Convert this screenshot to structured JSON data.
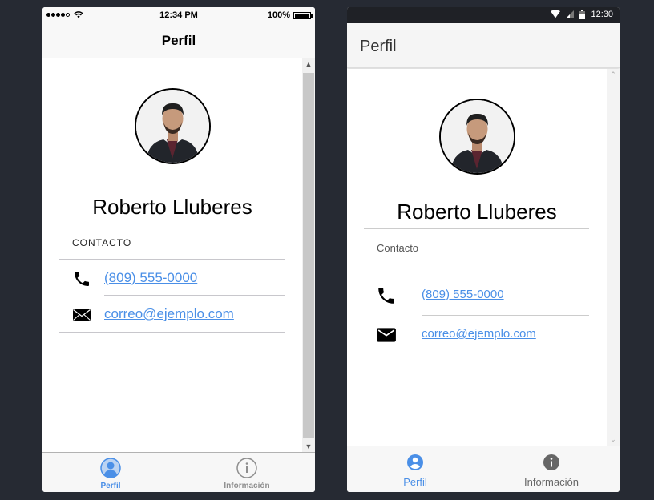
{
  "colors": {
    "accent": "#4a8fe7",
    "inactive": "#8e8e8e",
    "background": "#262a33"
  },
  "ios": {
    "status": {
      "time": "12:34 PM",
      "battery": "100%",
      "battery_level": 1.0
    },
    "nav_title": "Perfil",
    "profile": {
      "name": "Roberto Lluberes"
    },
    "section_title": "CONTACTO",
    "contacts": [
      {
        "icon": "phone-icon",
        "text": "(809) 555-0000"
      },
      {
        "icon": "mail-icon",
        "text": "correo@ejemplo.com"
      }
    ],
    "tabs": [
      {
        "icon": "person-icon",
        "label": "Perfil",
        "active": true
      },
      {
        "icon": "info-icon",
        "label": "Información",
        "active": false
      }
    ]
  },
  "android": {
    "status": {
      "time": "12:30"
    },
    "app_title": "Perfil",
    "profile": {
      "name": "Roberto Lluberes"
    },
    "section_title": "Contacto",
    "contacts": [
      {
        "icon": "phone-icon",
        "text": "(809) 555-0000"
      },
      {
        "icon": "mail-icon",
        "text": "correo@ejemplo.com"
      }
    ],
    "tabs": [
      {
        "icon": "account-circle-icon",
        "label": "Perfil",
        "active": true
      },
      {
        "icon": "info-icon",
        "label": "Información",
        "active": false
      }
    ]
  }
}
